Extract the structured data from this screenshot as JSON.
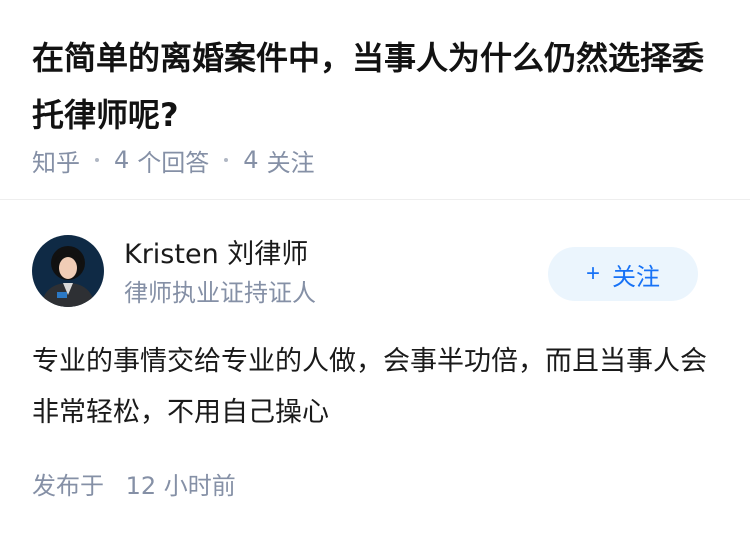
{
  "question": {
    "title": "在简单的离婚案件中，当事人为什么仍然选择委托律师呢?",
    "source": "知乎",
    "answers_count": "4",
    "answers_label": "个回答",
    "follows_count": "4",
    "follows_label": "关注"
  },
  "answer": {
    "author_name": "Kristen 刘律师",
    "author_bio": "律师执业证持证人",
    "follow_label": "关注",
    "follow_icon": "+",
    "content": "专业的事情交给专业的人做，会事半功倍，而且当事人会非常轻松，不用自己操心",
    "time_prefix": "发布于",
    "time_value": "12 小时前"
  },
  "colors": {
    "title": "#121212",
    "meta": "#8590a6",
    "accent": "#1772f6",
    "follow_bg": "#ebf5fd"
  },
  "icons": {
    "follow": "plus-icon",
    "avatar": "avatar"
  }
}
